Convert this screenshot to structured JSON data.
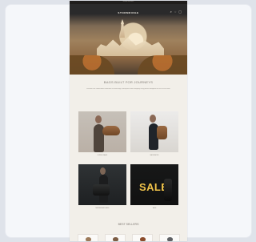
{
  "email": {
    "topbar_text": "SUNDAY DELIVERY",
    "brand": "STORMRIDGE",
    "top_icons": [
      "search-icon",
      "user-icon",
      "bag-icon"
    ],
    "section_title": "BAGS BUILT FOR JOURNEYS",
    "intro_text": "Discover our handcrafted collection of travel bags, backpacks and everyday carry pieces designed for life on the move.",
    "categories": [
      {
        "label": "DUFFLE BAGS"
      },
      {
        "label": "BACKPACKS"
      },
      {
        "label": "MESSENGER BAGS"
      },
      {
        "label": "SALE"
      }
    ],
    "sale_word": "SALE",
    "bestsellers_title": "BEST SELLERS",
    "product_colors": [
      "#9c7a5a",
      "#7d5d44",
      "#8b4c2c",
      "#5f6164"
    ]
  }
}
